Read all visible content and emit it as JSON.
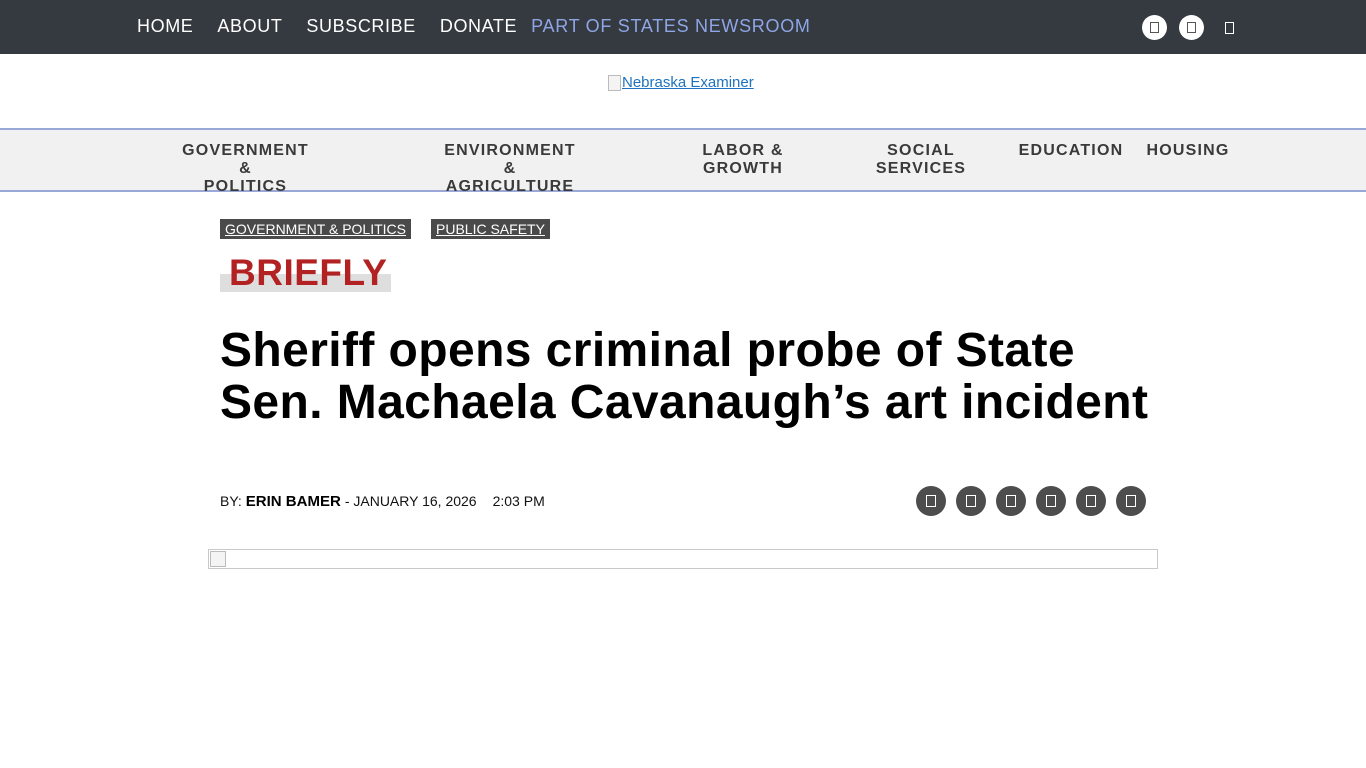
{
  "top_nav": {
    "items": [
      "HOME",
      "ABOUT",
      "SUBSCRIBE",
      "DONATE"
    ],
    "states_newsroom": "PART OF STATES NEWSROOM"
  },
  "top_social": {
    "icons": [
      "social-icon-1",
      "social-icon-2",
      "social-icon-3"
    ]
  },
  "logo": {
    "alt": "Nebraska Examiner"
  },
  "category_nav": {
    "items": [
      {
        "line1": "GOVERNMENT &",
        "line2": "POLITICS"
      },
      {
        "line1": "ENVIRONMENT &",
        "line2": "AGRICULTURE"
      },
      {
        "line1": "LABOR &",
        "line2": "GROWTH"
      },
      {
        "line1": "SOCIAL",
        "line2": "SERVICES"
      },
      {
        "line1": "EDUCATION",
        "line2": ""
      },
      {
        "line1": "HOUSING",
        "line2": ""
      }
    ]
  },
  "article": {
    "tags": [
      "GOVERNMENT & POLITICS",
      "PUBLIC SAFETY"
    ],
    "kicker": "BRIEFLY",
    "headline": "Sheriff opens criminal probe of State Sen. Machaela Cavanaugh’s art incident",
    "byline_prefix": "BY:",
    "author": "ERIN BAMER",
    "date": "- JANUARY 16, 2026",
    "time": "2:03 PM",
    "share_icons": [
      "share-icon-1",
      "share-icon-2",
      "share-icon-3",
      "share-icon-4",
      "share-icon-5",
      "share-icon-6"
    ]
  },
  "colors": {
    "topbar": "#343a40",
    "states_link": "#8fa6e6",
    "kicker": "#b22222",
    "tag_bg": "#4a4a4a",
    "nav_border": "#9aa8d8"
  }
}
